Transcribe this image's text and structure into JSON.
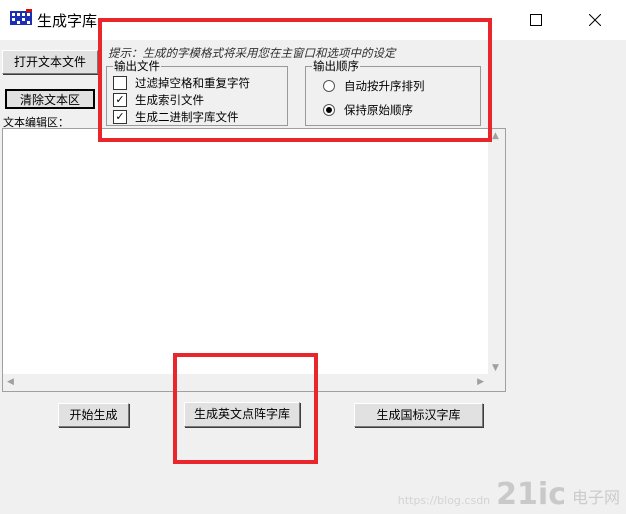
{
  "window": {
    "title": "生成字库",
    "icon": "app-grid-icon"
  },
  "buttons": {
    "open_file": "打开文本文件",
    "clear_text": "清除文本区",
    "start": "开始生成",
    "gen_english": "生成英文点阵字库",
    "gen_gb": "生成国标汉字库"
  },
  "hint": "提示：生成的字模格式将采用您在主窗口和选项中的设定",
  "output_file": {
    "legend": "输出文件",
    "options": [
      {
        "label": "过滤掉空格和重复字符",
        "checked": false,
        "mark": ""
      },
      {
        "label": "生成索引文件",
        "checked": true,
        "mark": "✓"
      },
      {
        "label": "生成二进制字库文件",
        "checked": true,
        "mark": "✓"
      }
    ]
  },
  "output_order": {
    "legend": "输出顺序",
    "options": [
      {
        "label": "自动按升序排列",
        "selected": false
      },
      {
        "label": "保持原始顺序",
        "selected": true
      }
    ]
  },
  "editor": {
    "label": "文本编辑区：",
    "value": ""
  },
  "watermark": {
    "url": "https://blog.csdn",
    "logo": "21ic",
    "text": "电子网"
  },
  "colors": {
    "highlight": "#e8262b",
    "window_bg": "#f0f0f0"
  }
}
